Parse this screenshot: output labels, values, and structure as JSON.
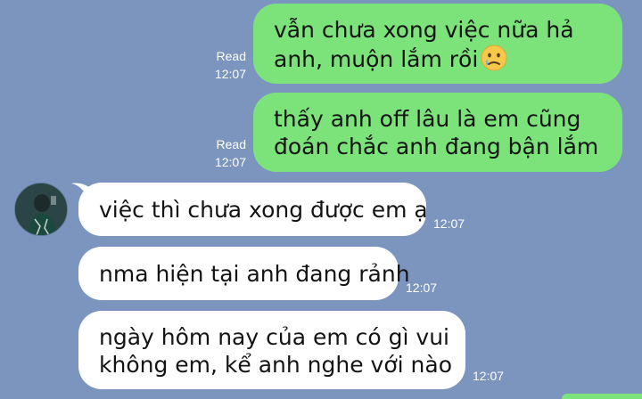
{
  "messages": [
    {
      "direction": "sent",
      "lines": [
        "vẫn chưa xong việc nữa hả",
        "anh, muộn lắm rồi"
      ],
      "emoji": "crying-face-emoji",
      "read_label": "Read",
      "time": "12:07"
    },
    {
      "direction": "sent",
      "lines": [
        "thấy anh off lâu là em cũng",
        "đoán chắc anh đang bận lắm"
      ],
      "read_label": "Read",
      "time": "12:07"
    },
    {
      "direction": "received",
      "lines": [
        "việc thì chưa xong được em ạ"
      ],
      "time": "12:07"
    },
    {
      "direction": "received",
      "lines": [
        "nma hiện tại anh đang rảnh"
      ],
      "time": "12:07"
    },
    {
      "direction": "received",
      "lines": [
        "ngày hôm nay của em có gì vui",
        "không em, kể anh nghe với nào"
      ],
      "time": "12:07"
    }
  ],
  "colors": {
    "background": "#7b95be",
    "sent_bubble": "#7ce27a",
    "received_bubble": "#ffffff",
    "meta_text": "#ffffff"
  },
  "avatar": "contact-avatar"
}
